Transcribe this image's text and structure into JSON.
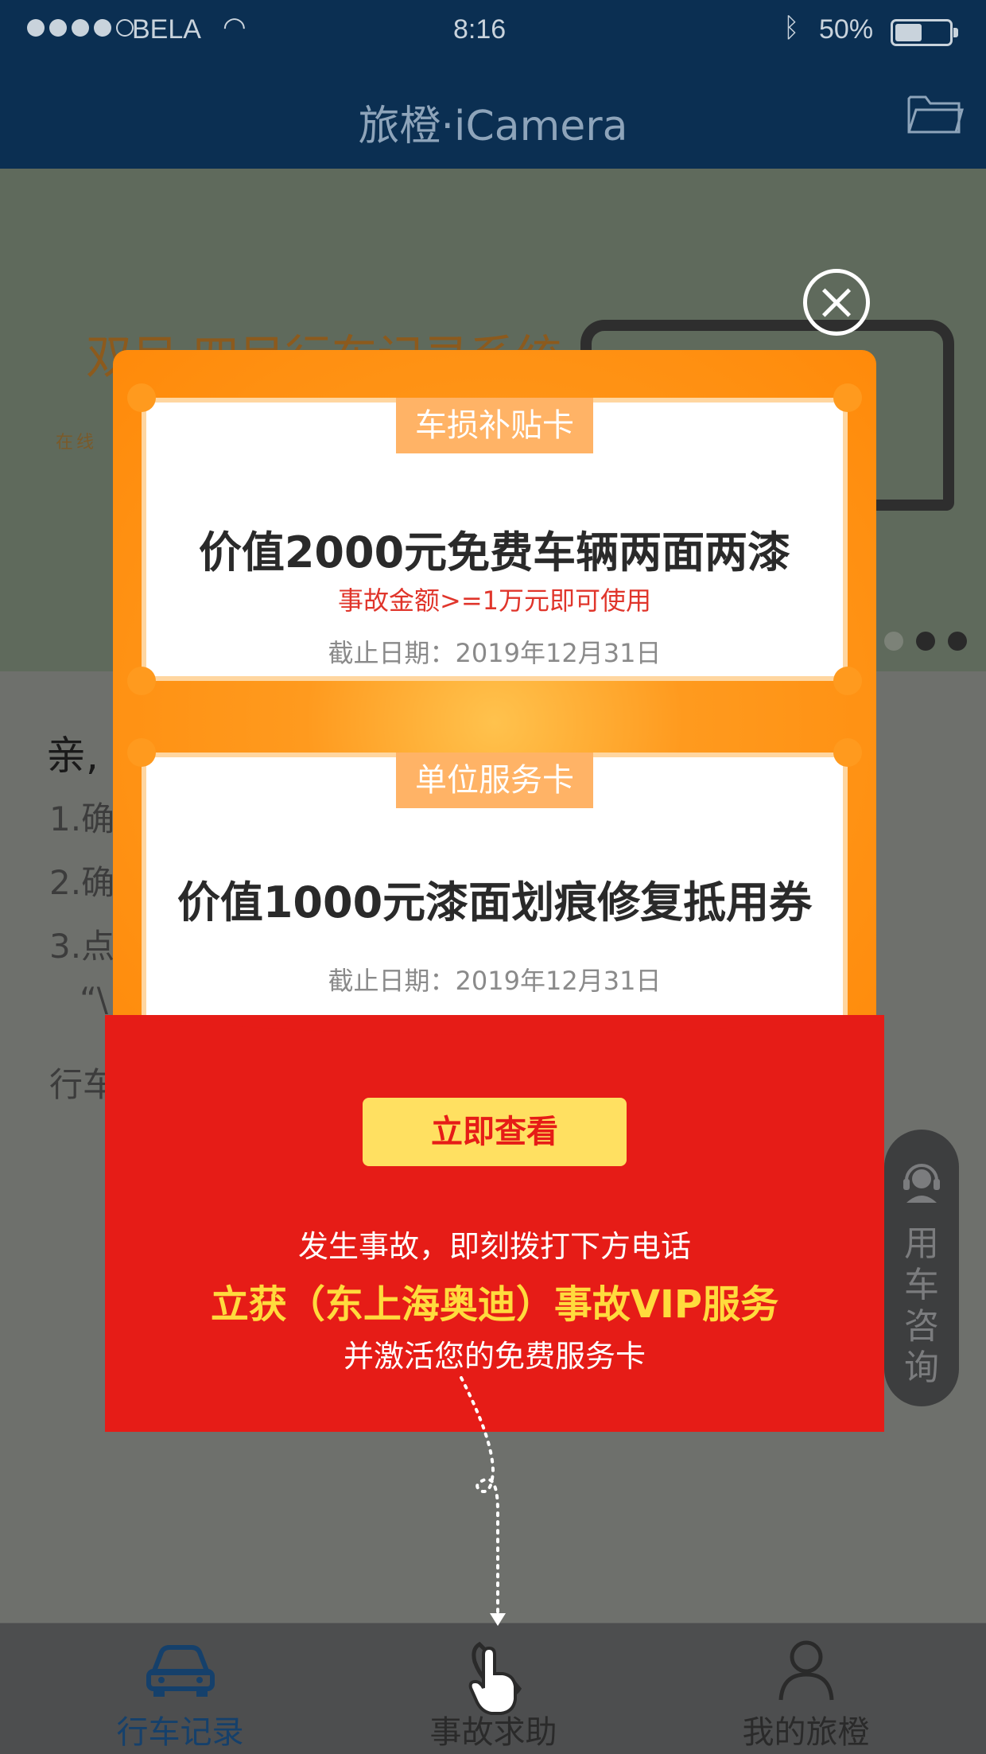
{
  "status_bar": {
    "carrier": "BELA",
    "time": "8:16",
    "battery": "50%",
    "battery_level": 0.5
  },
  "nav": {
    "title": "旅橙·iCamera",
    "folder_icon": "folder-icon"
  },
  "banner": {
    "title": "双目·四目行车记录系统",
    "subtitle": "在线",
    "pages": 3,
    "active_page": 2
  },
  "content": {
    "greeting": "亲,",
    "lines": [
      "1.确",
      "2.确",
      "3.点",
      "“\\",
      "行车"
    ]
  },
  "consult": {
    "label": "用车咨询",
    "icon": "headset-icon"
  },
  "modal": {
    "coupon1": {
      "tag": "车损补贴卡",
      "title": "价值2000元免费车辆两面两漆",
      "condition": "事故金额>=1万元即可使用",
      "deadline": "截止日期：2019年12月31日"
    },
    "coupon2": {
      "tag": "单位服务卡",
      "title": "价值1000元漆面划痕修复抵用券",
      "deadline": "截止日期：2019年12月31日"
    },
    "cta_label": "立即查看",
    "line1": "发生事故，即刻拨打下方电话",
    "line2": "立获（东上海奥迪）事故VIP服务",
    "line3": "并激活您的免费服务卡",
    "colors": {
      "orange": "#ff8a0a",
      "red": "#e61c17",
      "yellow": "#ffe061",
      "highlight": "#ffdb3d"
    }
  },
  "tabs": [
    {
      "label": "行车记录",
      "icon": "car-icon",
      "active": true
    },
    {
      "label": "事故求助",
      "icon": "phone-icon",
      "active": false
    },
    {
      "label": "我的旅橙",
      "icon": "user-icon",
      "active": false
    }
  ]
}
